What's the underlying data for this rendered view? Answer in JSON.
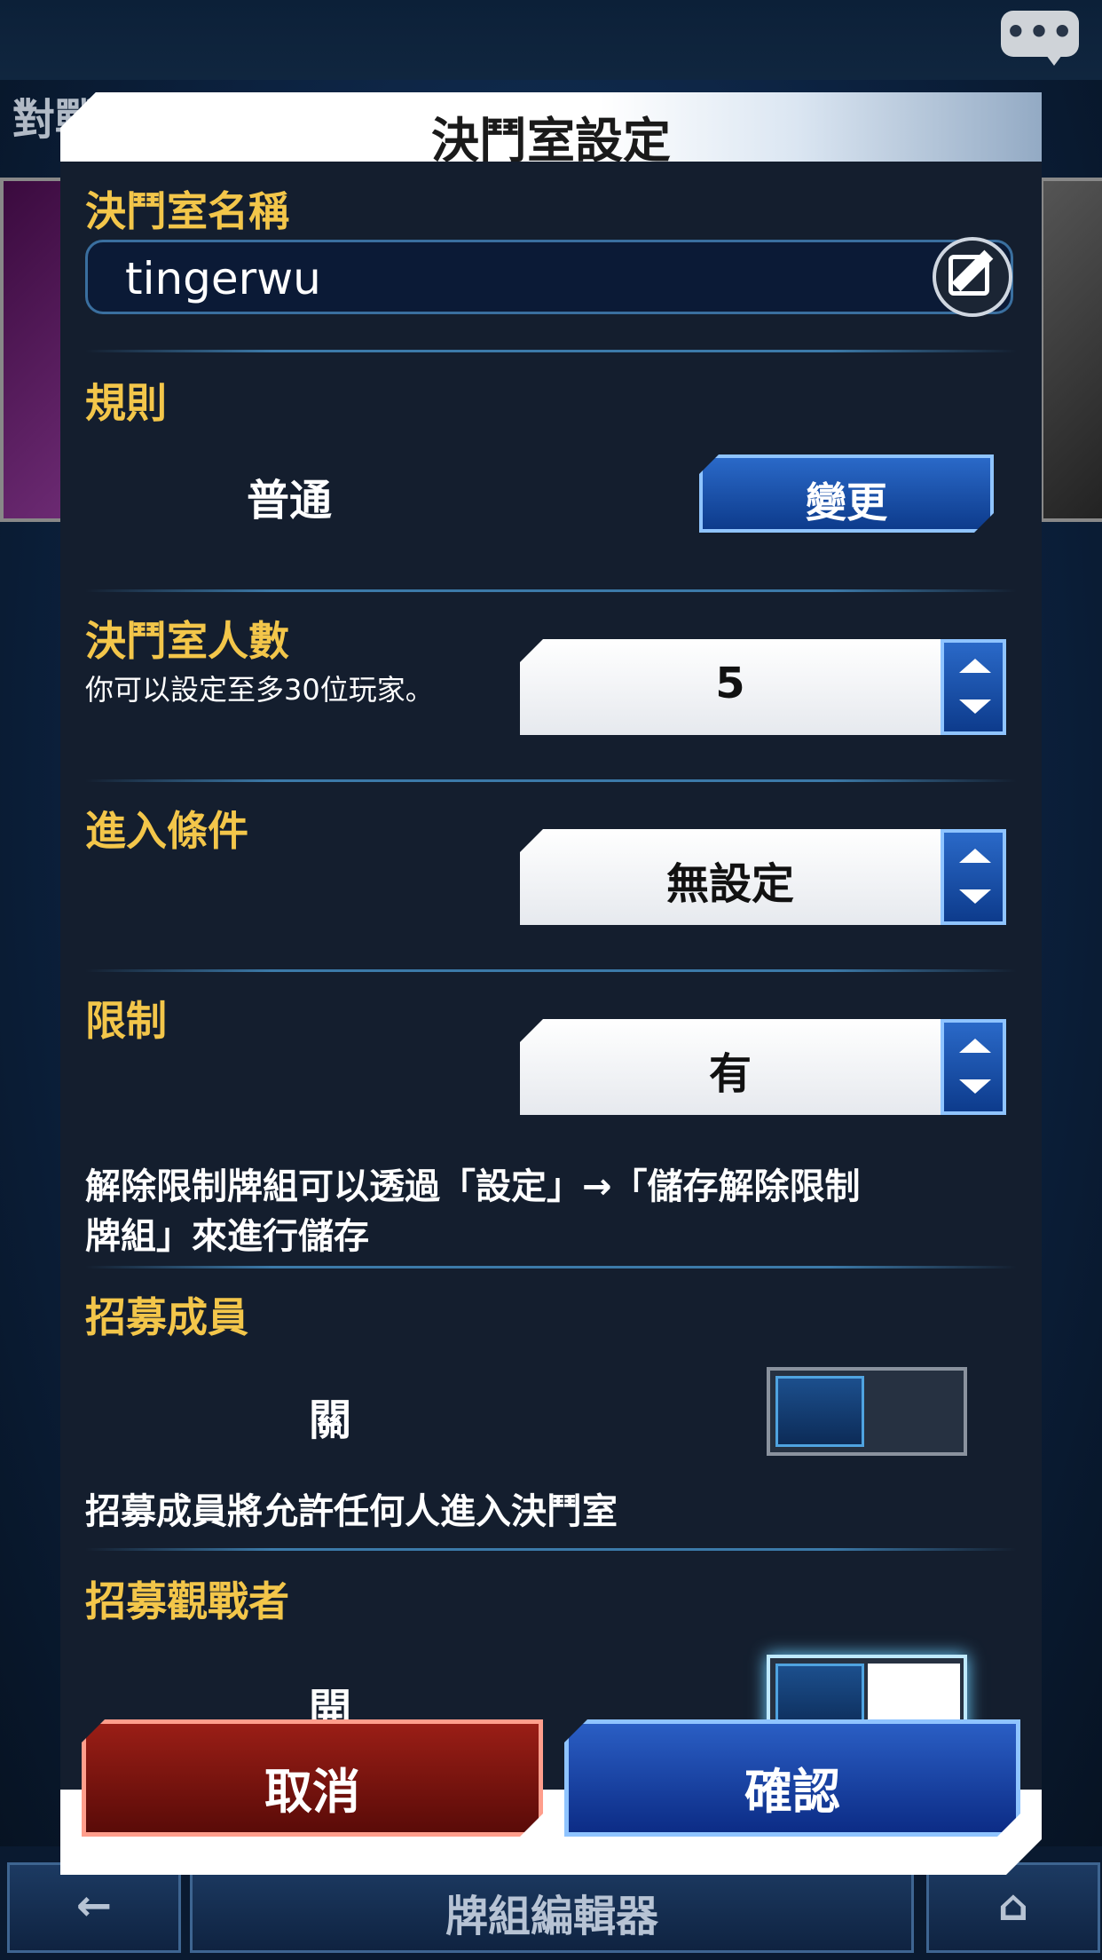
{
  "background": {
    "title": "對戰模式",
    "bottom_center_label": "牌組編輯器"
  },
  "dialog": {
    "title": "決鬥室設定",
    "room_name": {
      "label": "決鬥室名稱",
      "value": "tingerwu"
    },
    "rule": {
      "label": "規則",
      "value": "普通",
      "change_button": "變更"
    },
    "room_size": {
      "label": "決鬥室人數",
      "hint": "你可以設定至多30位玩家。",
      "value": "5"
    },
    "entry_condition": {
      "label": "進入條件",
      "value": "無設定"
    },
    "restriction": {
      "label": "限制",
      "value": "有",
      "note_line1": "解除限制牌組可以透過「設定」→「儲存解除限制",
      "note_line2": "牌組」來進行儲存"
    },
    "recruit_members": {
      "label": "招募成員",
      "state": "關",
      "note": "招募成員將允許任何人進入決鬥室"
    },
    "recruit_spectators": {
      "label": "招募觀戰者",
      "state": "開"
    }
  },
  "footer": {
    "cancel": "取消",
    "confirm": "確認"
  }
}
